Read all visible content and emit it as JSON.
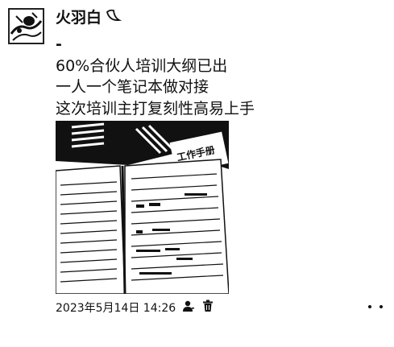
{
  "post": {
    "author": "火羽白",
    "lines": [
      "-",
      "60%合伙人培训大纲已出",
      "一人一个笔记本做对接",
      "这次培训主打复刻性高易上手"
    ],
    "photo_caption_text": "工作手册",
    "timestamp": "2023年5月14日 14:26"
  },
  "icons": {
    "author_badge": "moon-emoji-icon",
    "visibility": "person-icon",
    "delete": "trash-icon",
    "more": "more-dots-icon"
  }
}
